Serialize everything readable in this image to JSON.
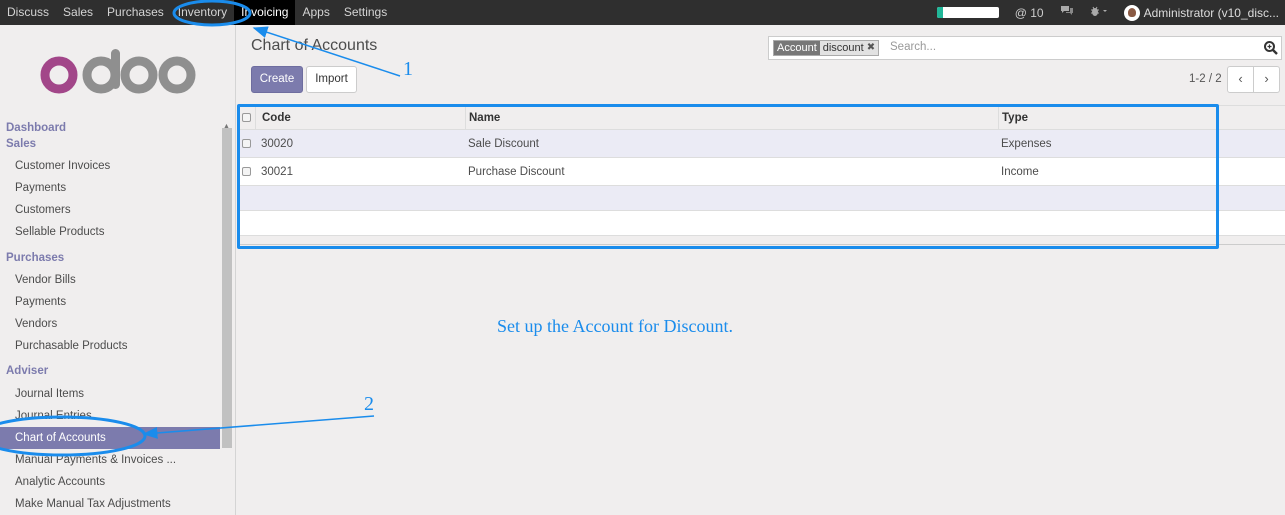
{
  "topbar": {
    "menus": [
      "Discuss",
      "Sales",
      "Purchases",
      "Inventory",
      "Invoicing",
      "Apps",
      "Settings"
    ],
    "active_menu": "Invoicing",
    "progress_fraction": 0.1,
    "mentions": "@ 10",
    "user": "Administrator (v10_disc..."
  },
  "sidebar": {
    "sections": [
      {
        "title": "Dashboard",
        "items": []
      },
      {
        "title": "Sales",
        "items": [
          "Customer Invoices",
          "Payments",
          "Customers",
          "Sellable Products"
        ]
      },
      {
        "title": "Purchases",
        "items": [
          "Vendor Bills",
          "Payments",
          "Vendors",
          "Purchasable Products"
        ]
      },
      {
        "title": "Adviser",
        "items": [
          "Journal Items",
          "Journal Entries",
          "Chart of Accounts",
          "Manual Payments & Invoices ...",
          "Analytic Accounts",
          "Make Manual Tax Adjustments"
        ]
      }
    ],
    "active_item": "Chart of Accounts"
  },
  "main": {
    "title": "Chart of Accounts",
    "create_label": "Create",
    "import_label": "Import",
    "search": {
      "facet_label": "Account",
      "facet_value": "discount",
      "placeholder": "Search..."
    },
    "pager": "1-2 / 2",
    "table": {
      "columns": [
        "Code",
        "Name",
        "Type"
      ],
      "rows": [
        [
          "30020",
          "Sale Discount",
          "Expenses"
        ],
        [
          "30021",
          "Purchase Discount",
          "Income"
        ]
      ]
    }
  },
  "annotations": {
    "marker_1": "1",
    "marker_2": "2",
    "note": "Set up the Account for Discount."
  },
  "colors": {
    "accent": "#7c7bad",
    "annotation": "#1a8cec"
  }
}
